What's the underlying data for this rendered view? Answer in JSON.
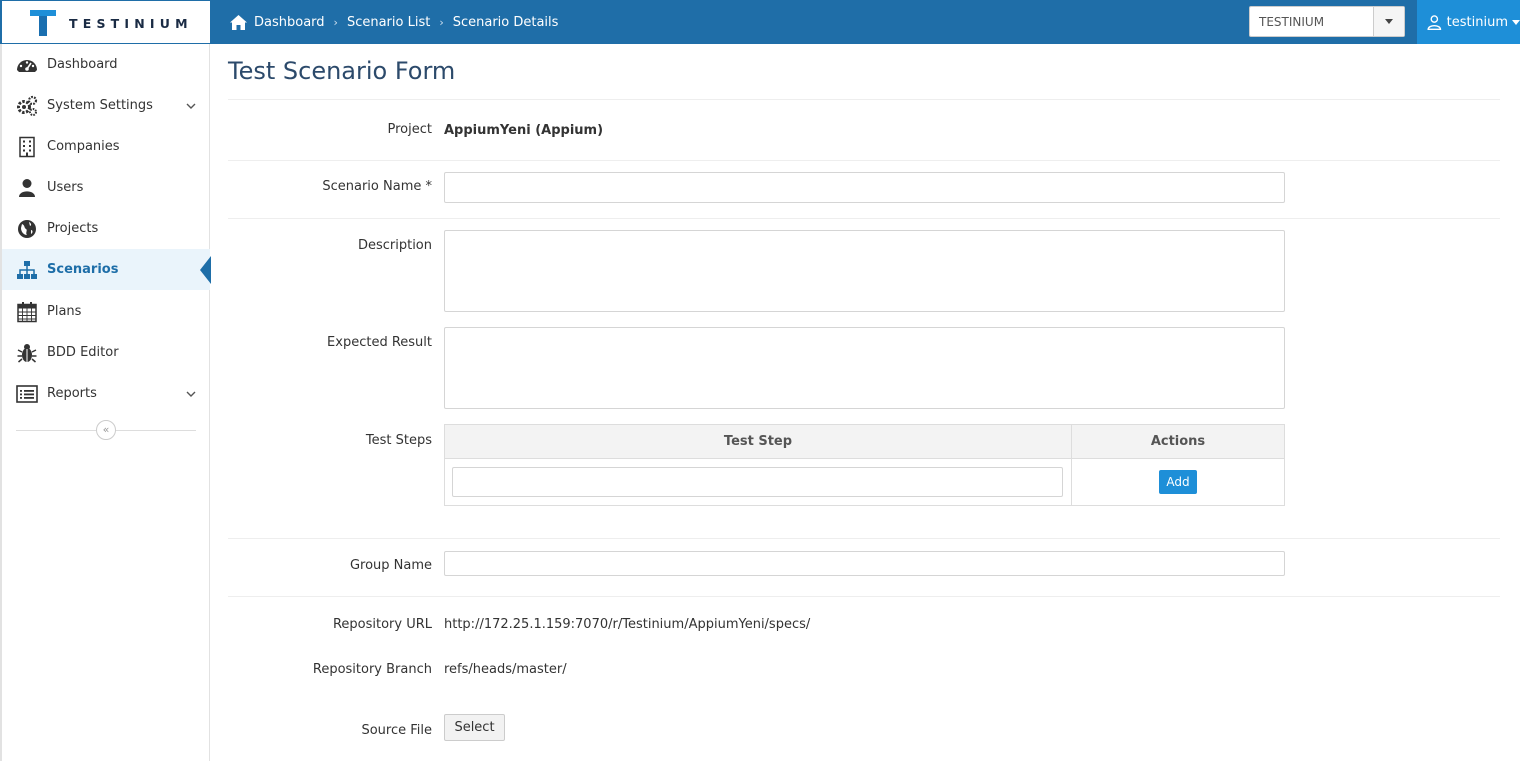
{
  "app": {
    "logo_text": "TESTINIUM",
    "brand_color": "#1f6ea8",
    "accent_color": "#1e8fd8"
  },
  "breadcrumb": {
    "items": [
      "Dashboard",
      "Scenario List",
      "Scenario Details"
    ]
  },
  "header": {
    "org_select_value": "TESTINIUM",
    "user_label": "testinium"
  },
  "sidebar": {
    "items": [
      {
        "label": "Dashboard",
        "icon": "dashboard-icon"
      },
      {
        "label": "System Settings",
        "icon": "gears-icon",
        "expandable": true
      },
      {
        "label": "Companies",
        "icon": "building-icon"
      },
      {
        "label": "Users",
        "icon": "user-icon"
      },
      {
        "label": "Projects",
        "icon": "globe-icon"
      },
      {
        "label": "Scenarios",
        "icon": "sitemap-icon",
        "active": true
      },
      {
        "label": "Plans",
        "icon": "calendar-icon"
      },
      {
        "label": "BDD Editor",
        "icon": "bug-icon"
      },
      {
        "label": "Reports",
        "icon": "list-icon",
        "expandable": true
      }
    ],
    "collapse_glyph": "«"
  },
  "form": {
    "title": "Test Scenario Form",
    "project_label": "Project",
    "project_value": "AppiumYeni (Appium)",
    "scenario_name_label": "Scenario Name *",
    "scenario_name_value": "",
    "description_label": "Description",
    "description_value": "",
    "expected_result_label": "Expected Result",
    "expected_result_value": "",
    "test_steps_label": "Test Steps",
    "steps_table": {
      "columns": [
        "Test Step",
        "Actions"
      ],
      "new_step_value": "",
      "add_label": "Add"
    },
    "group_name_label": "Group Name",
    "group_name_value": "",
    "repository_url_label": "Repository URL",
    "repository_url_value": "http://172.25.1.159:7070/r/Testinium/AppiumYeni/specs/",
    "repository_branch_label": "Repository Branch",
    "repository_branch_value": "refs/heads/master/",
    "source_file_label": "Source File",
    "select_label": "Select"
  }
}
